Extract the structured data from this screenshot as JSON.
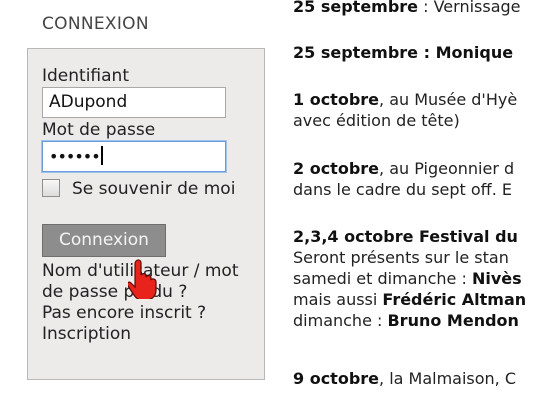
{
  "login": {
    "title": "CONNEXION",
    "username_label": "Identifiant",
    "username_value": "ADupond",
    "password_label": "Mot de passe",
    "password_value": "••••••",
    "remember_label": "Se souvenir de moi",
    "submit_label": "Connexion",
    "forgot_link": "Nom d'utilisateur / mot de passe perdu ?",
    "register_prompt": "Pas encore inscrit ?",
    "register_link": "Inscription"
  },
  "events": [
    {
      "line1_bold": "25 septembre",
      "line1_rest": " : Vernissage"
    },
    {
      "line1_bold": "25 septembre : Monique",
      "line1_rest": ""
    },
    {
      "line1_bold": "1 octobre",
      "line1_rest": ", au Musée d'Hyè",
      "line2": "avec édition de tête)"
    },
    {
      "line1_bold": "2 octobre",
      "line1_rest": ", au Pigeonnier d",
      "line2": "dans le cadre du sept off. E"
    },
    {
      "line1_bold": "2,3,4 octobre Festival du",
      "line2": "Seront présents sur le stan",
      "line3": "samedi et dimanche : ",
      "line3_bold": "Nivès",
      "line4": "mais aussi ",
      "line4_bold": "Frédéric Altman",
      "line5": "dimanche : ",
      "line5_bold": "Bruno Mendon"
    },
    {
      "line1_bold": "9 octobre",
      "line1_rest": ", la Malmaison, C"
    }
  ]
}
